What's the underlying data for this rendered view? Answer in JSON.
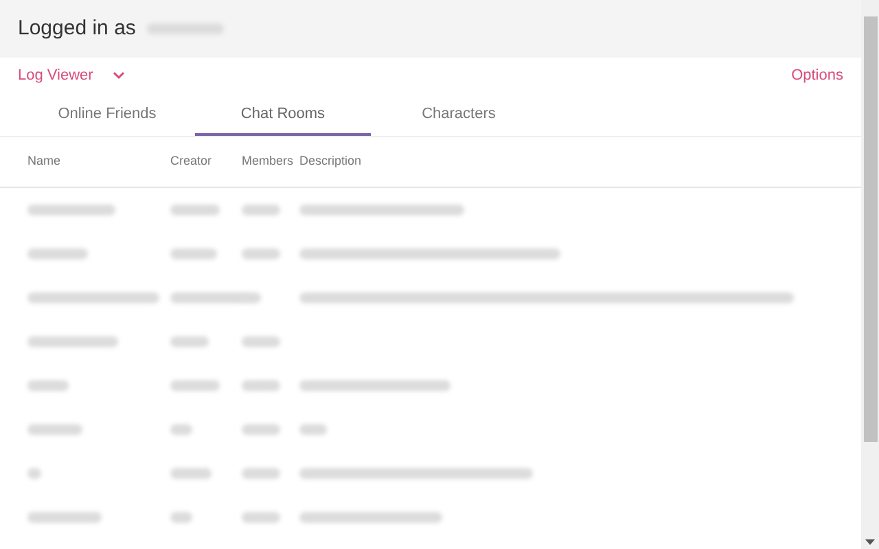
{
  "header": {
    "title": "Logged in as"
  },
  "toolbar": {
    "menu": "Log Viewer",
    "options": "Options"
  },
  "tabs": [
    {
      "label": "Online Friends",
      "selected": false
    },
    {
      "label": "Chat Rooms",
      "selected": true
    },
    {
      "label": "Characters",
      "selected": false
    }
  ],
  "table": {
    "columns": [
      "Name",
      "Creator",
      "Members",
      "Description"
    ],
    "rows": [
      {
        "has_description": true
      },
      {
        "has_description": true
      },
      {
        "has_description": true
      },
      {
        "has_description": false
      },
      {
        "has_description": true
      },
      {
        "has_description": true
      },
      {
        "has_description": true
      },
      {
        "has_description": true
      }
    ]
  }
}
